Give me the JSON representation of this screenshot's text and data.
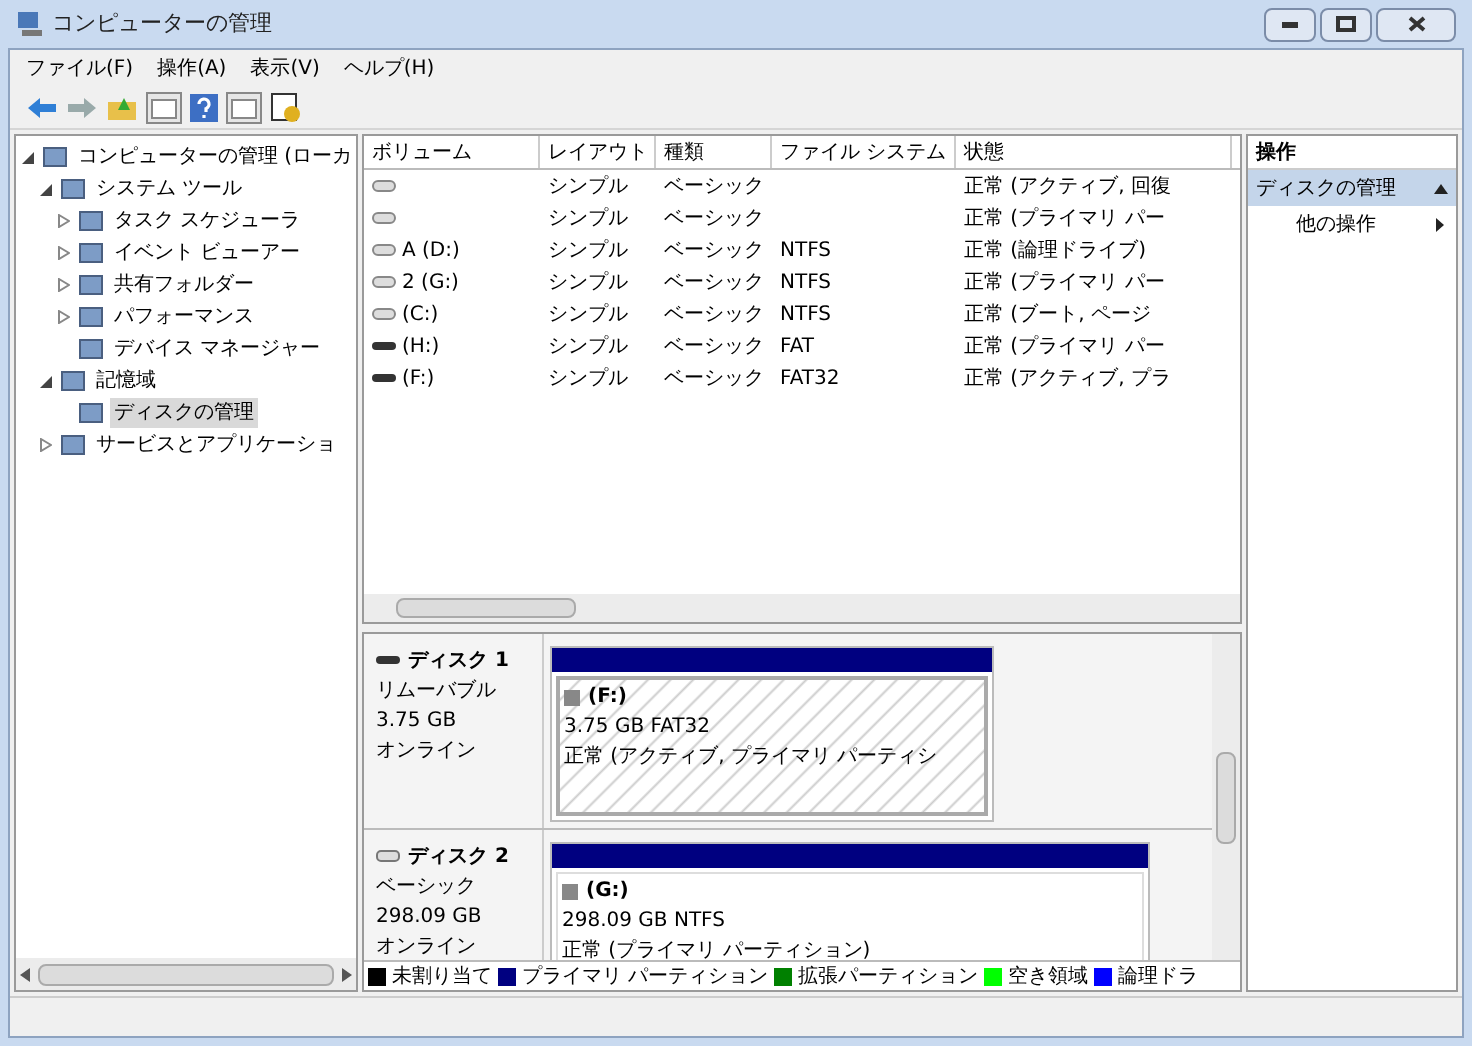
{
  "window": {
    "title": "コンピューターの管理"
  },
  "menu": [
    "ファイル(F)",
    "操作(A)",
    "表示(V)",
    "ヘルプ(H)"
  ],
  "tree": [
    {
      "label": "コンピューターの管理 (ローカ",
      "expanded": true,
      "selected": false,
      "children": [
        {
          "label": "システム ツール",
          "expanded": true,
          "selected": false,
          "children": [
            {
              "label": "タスク スケジューラ",
              "expanded": false,
              "selected": false
            },
            {
              "label": "イベント ビューアー",
              "expanded": false,
              "selected": false
            },
            {
              "label": "共有フォルダー",
              "expanded": false,
              "selected": false
            },
            {
              "label": "パフォーマンス",
              "expanded": false,
              "selected": false
            },
            {
              "label": "デバイス マネージャー",
              "selected": false
            }
          ]
        },
        {
          "label": "記憶域",
          "expanded": true,
          "selected": false,
          "children": [
            {
              "label": "ディスクの管理",
              "selected": true
            }
          ]
        },
        {
          "label": "サービスとアプリケーショ",
          "expanded": false,
          "selected": false
        }
      ]
    }
  ],
  "table": {
    "columns": [
      "ボリューム",
      "レイアウト",
      "種類",
      "ファイル システム",
      "状態"
    ],
    "rows": [
      {
        "kind": "fixed",
        "cells": [
          "",
          "シンプル",
          "ベーシック",
          "",
          "正常 (アクティブ, 回復"
        ]
      },
      {
        "kind": "fixed",
        "cells": [
          "",
          "シンプル",
          "ベーシック",
          "",
          "正常 (プライマリ パー"
        ]
      },
      {
        "kind": "fixed",
        "cells": [
          "A (D:)",
          "シンプル",
          "ベーシック",
          "NTFS",
          "正常 (論理ドライブ)"
        ]
      },
      {
        "kind": "fixed",
        "cells": [
          "2 (G:)",
          "シンプル",
          "ベーシック",
          "NTFS",
          "正常 (プライマリ パー"
        ]
      },
      {
        "kind": "fixed",
        "cells": [
          "(C:)",
          "シンプル",
          "ベーシック",
          "NTFS",
          "正常 (ブート, ページ"
        ]
      },
      {
        "kind": "removable",
        "cells": [
          "(H:)",
          "シンプル",
          "ベーシック",
          "FAT",
          "正常 (プライマリ パー"
        ]
      },
      {
        "kind": "removable",
        "cells": [
          "(F:)",
          "シンプル",
          "ベーシック",
          "FAT32",
          "正常 (アクティブ, プラ"
        ]
      }
    ]
  },
  "disks": [
    {
      "kind": "removable",
      "name": "ディスク 1",
      "type": "リムーバブル",
      "size": "3.75 GB",
      "status": "オンライン",
      "partition": {
        "label": "(F:)",
        "size": "3.75 GB FAT32",
        "status": "正常 (アクティブ, プライマリ パーティシ",
        "selected": true
      }
    },
    {
      "kind": "fixed",
      "name": "ディスク 2",
      "type": "ベーシック",
      "size": "298.09 GB",
      "status": "オンライン",
      "partition": {
        "label": "(G:)",
        "size": "298.09 GB NTFS",
        "status": "正常 (プライマリ パーティション)",
        "selected": false
      }
    }
  ],
  "legend": [
    {
      "label": "未割り当て",
      "color": "#000000"
    },
    {
      "label": "プライマリ パーティション",
      "color": "#000080"
    },
    {
      "label": "拡張パーティション",
      "color": "#008000"
    },
    {
      "label": "空き領域",
      "color": "#00ff00"
    },
    {
      "label": "論理ドラ",
      "color": "#0000ff"
    }
  ],
  "actions": {
    "header": "操作",
    "section": "ディスクの管理",
    "items": [
      "他の操作"
    ]
  }
}
